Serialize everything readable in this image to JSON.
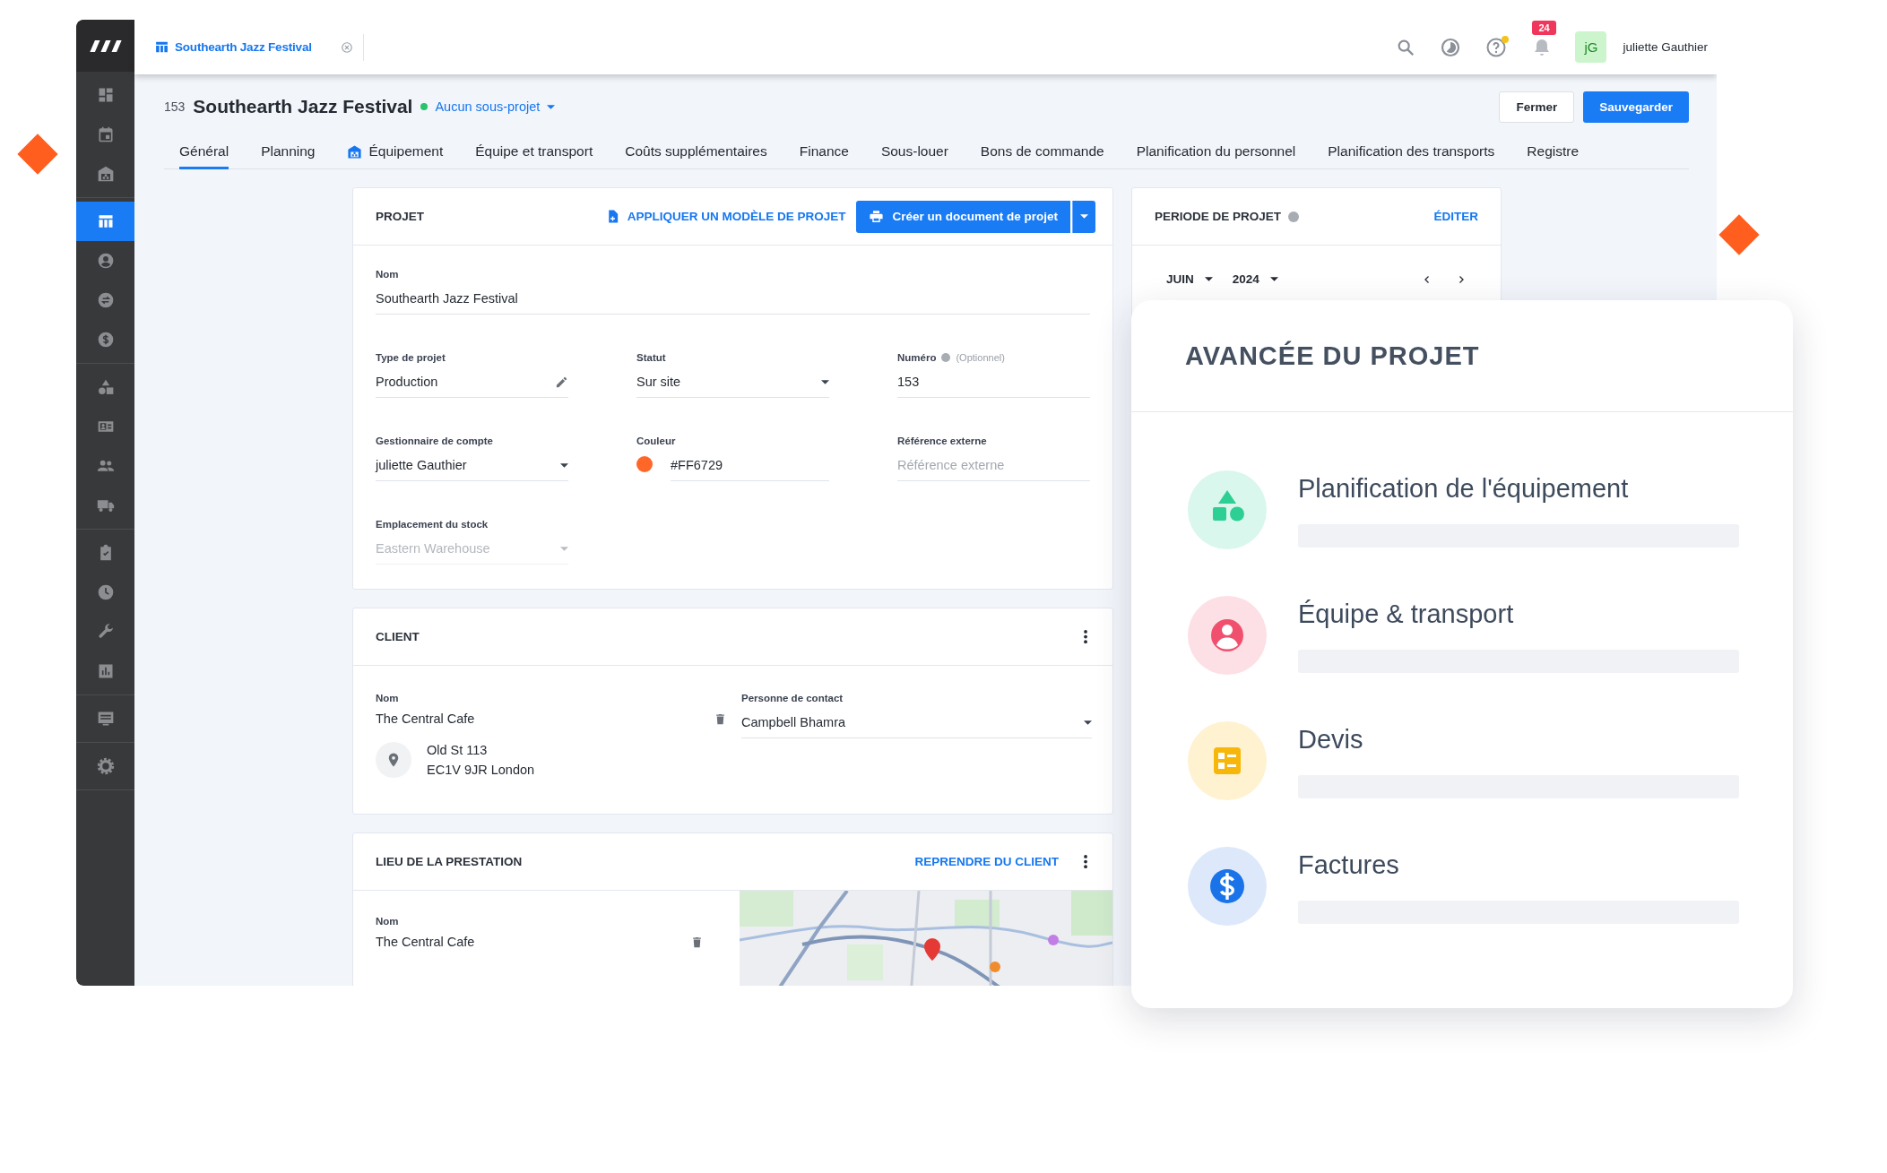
{
  "topbar": {
    "document_tab": "Southearth Jazz Festival",
    "help_unread": true,
    "notifications": "24",
    "avatar": "jG",
    "user_name": "juliette Gauthier"
  },
  "sidebar": {
    "groups": [
      [
        {
          "selected": false
        },
        {
          "selected": false
        },
        {
          "selected": false
        }
      ],
      [
        {
          "selected": true
        },
        {
          "selected": false
        },
        {
          "selected": false
        },
        {
          "selected": false
        }
      ],
      [
        {
          "selected": false
        },
        {
          "selected": false
        },
        {
          "selected": false
        },
        {
          "selected": false
        }
      ],
      [
        {
          "selected": false
        },
        {
          "selected": false
        },
        {
          "selected": false
        },
        {
          "selected": false
        }
      ],
      [
        {
          "selected": false
        }
      ],
      [
        {
          "selected": false
        }
      ]
    ]
  },
  "header": {
    "number": "153",
    "title": "Southearth Jazz Festival",
    "subproject": "Aucun sous-projet",
    "buttons": [
      {
        "label": "Fermer",
        "kind": "secondary"
      },
      {
        "label": "Sauvegarder",
        "kind": "primary"
      }
    ]
  },
  "tabs": [
    {
      "label": "Général",
      "kind": "plain",
      "selected": true
    },
    {
      "label": "Planning",
      "kind": "plain",
      "selected": false
    },
    {
      "label": "Équipement",
      "kind": "icon",
      "selected": false
    },
    {
      "label": "Équipe et transport",
      "kind": "plain",
      "selected": false
    },
    {
      "label": "Coûts supplémentaires",
      "kind": "plain",
      "selected": false
    },
    {
      "label": "Finance",
      "kind": "plain",
      "selected": false
    },
    {
      "label": "Sous-louer",
      "kind": "plain",
      "selected": false
    },
    {
      "label": "Bons de commande",
      "kind": "plain",
      "selected": false
    },
    {
      "label": "Planification du personnel",
      "kind": "plain",
      "selected": false
    },
    {
      "label": "Planification des transports",
      "kind": "plain",
      "selected": false
    },
    {
      "label": "Registre",
      "kind": "plain",
      "selected": false
    }
  ],
  "project_card": {
    "title": "PROJET",
    "template_link": "APPLIQUER UN MODÈLE DE PROJET",
    "document_button": "Créer un document de projet",
    "fields": [
      {
        "kind": "text",
        "label": "Nom",
        "value": "Southearth Jazz Festival",
        "disabled": false
      },
      {
        "kind": "edit",
        "label": "Type de projet",
        "value": "Production",
        "disabled": false
      },
      {
        "kind": "select",
        "label": "Statut",
        "value": "Sur site",
        "disabled": false
      },
      {
        "kind": "text",
        "label": "Numéro",
        "hint": "(Optionnel)",
        "value": "153",
        "disabled": false
      },
      {
        "kind": "select",
        "label": "Gestionnaire de compte",
        "value": "juliette Gauthier",
        "disabled": false
      },
      {
        "kind": "color",
        "label": "Couleur",
        "value": "#FF6729",
        "disabled": false
      },
      {
        "kind": "text",
        "label": "Référence externe",
        "placeholder": "Référence externe",
        "disabled": false
      },
      {
        "kind": "select",
        "label": "Emplacement du stock",
        "value": "Eastern Warehouse",
        "disabled": true
      }
    ]
  },
  "client_card": {
    "title": "CLIENT",
    "name_label": "Nom",
    "name": "The Central Cafe",
    "address": [
      "Old St 113",
      "EC1V 9JR London"
    ],
    "contact_label": "Personne de contact",
    "contact": "Campbell Bhamra"
  },
  "venue_card": {
    "title": "LIEU DE LA PRESTATION",
    "action": "REPRENDRE DU CLIENT",
    "name_label": "Nom",
    "name": "The Central Cafe"
  },
  "period_card": {
    "title": "PERIODE DE PROJET",
    "action": "ÉDITER",
    "month": "JUIN",
    "year": "2024"
  },
  "progress": {
    "title": "AVANCÉE DU PROJET",
    "items": [
      {
        "kind": "equipment",
        "label": "Planification de l'équipement"
      },
      {
        "kind": "crew",
        "label": "Équipe & transport"
      },
      {
        "kind": "quote",
        "label": "Devis"
      },
      {
        "kind": "invoice",
        "label": "Factures"
      }
    ]
  }
}
